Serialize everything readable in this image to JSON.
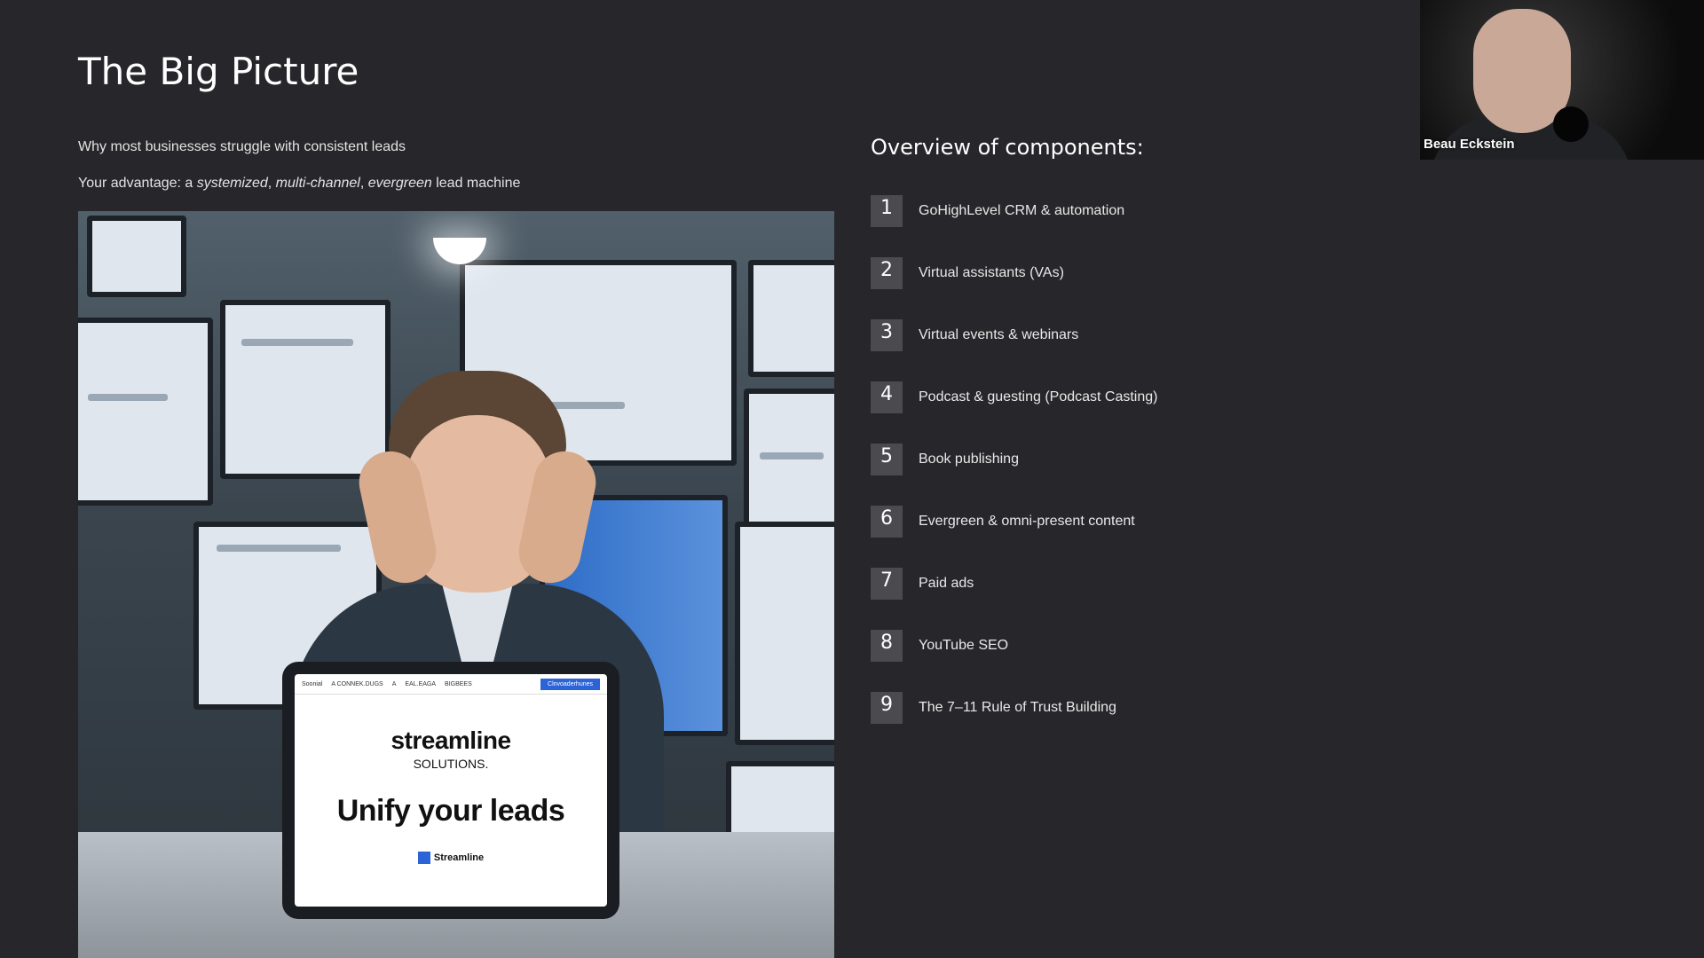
{
  "slide": {
    "title": "The Big Picture",
    "subtitle_1": "Why most businesses struggle with consistent leads",
    "subtitle_2": {
      "prefix": "Your advantage: a ",
      "word_1": "systemized",
      "sep_1": ", ",
      "word_2": "multi-channel",
      "sep_2": ", ",
      "word_3": "evergreen",
      "suffix": " lead machine"
    }
  },
  "hero_image": {
    "tablet": {
      "nav_logo": "Soonial",
      "nav_items": [
        "A CONNEK.DUGS",
        "A",
        "EAL.EAGA",
        "BIGBEES"
      ],
      "nav_cta": "Clnvoaderhunes",
      "brand": "streamline",
      "brand_sub": "SOLUTIONS.",
      "headline": "Unify your leads",
      "footer_logo": "Streamline"
    }
  },
  "components": {
    "heading": "Overview of components:",
    "items": [
      {
        "num": "1",
        "label": "GoHighLevel CRM & automation"
      },
      {
        "num": "2",
        "label": "Virtual assistants (VAs)"
      },
      {
        "num": "3",
        "label": "Virtual events & webinars"
      },
      {
        "num": "4",
        "label": "Podcast & guesting (Podcast Casting)"
      },
      {
        "num": "5",
        "label": "Book publishing"
      },
      {
        "num": "6",
        "label": "Evergreen & omni-present content"
      },
      {
        "num": "7",
        "label": "Paid ads"
      },
      {
        "num": "8",
        "label": "YouTube SEO"
      },
      {
        "num": "9",
        "label": "The 7–11 Rule of Trust Building"
      }
    ]
  },
  "webcam": {
    "name": "Beau Eckstein"
  }
}
